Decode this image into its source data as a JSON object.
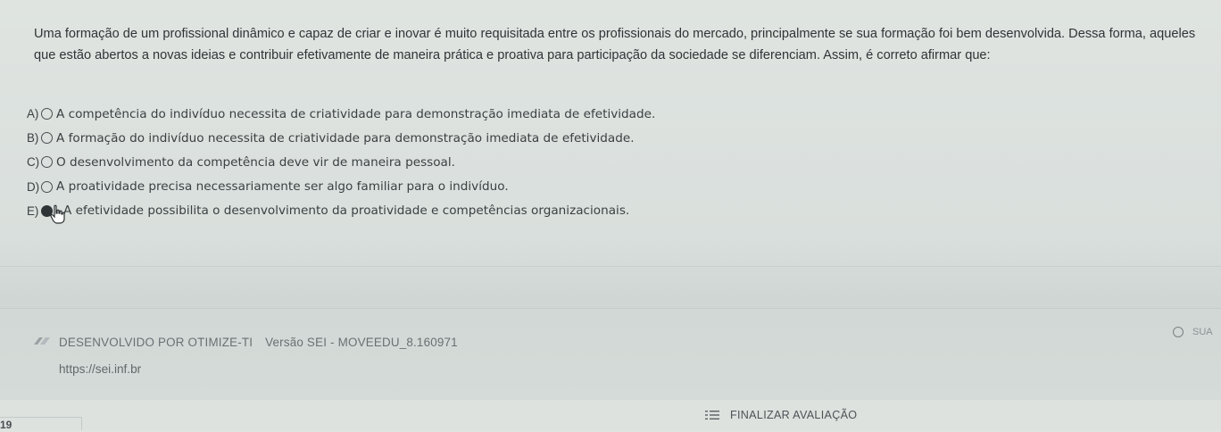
{
  "question": {
    "text": "Uma formação de um profissional dinâmico e capaz de criar e inovar é muito requisitada entre os profissionais do mercado, principalmente se sua formação foi bem desenvolvida. Dessa forma, aqueles que estão abertos a novas ideias e contribuir efetivamente de maneira prática e proativa para participação da sociedade se diferenciam. Assim, é correto afirmar que:"
  },
  "options": [
    {
      "letter": "A)",
      "text": "A competência do indivíduo necessita de criatividade para demonstração imediata de efetividade.",
      "selected": false
    },
    {
      "letter": "B)",
      "text": "A formação do indivíduo necessita de criatividade para demonstração imediata de efetividade.",
      "selected": false
    },
    {
      "letter": "C)",
      "text": "O desenvolvimento da competência deve vir de maneira pessoal.",
      "selected": false
    },
    {
      "letter": "D)",
      "text": "A proatividade precisa necessariamente ser algo familiar para o indivíduo.",
      "selected": false
    },
    {
      "letter": "E)",
      "text": "A efetividade possibilita o desenvolvimento da proatividade e competências organizacionais.",
      "selected": true
    }
  ],
  "footer": {
    "developer": "DESENVOLVIDO POR OTIMIZE-TI",
    "version": "Versão SEI - MOVEEDU_8.160971",
    "url": "https://sei.inf.br",
    "right_label": "SUA"
  },
  "bottom_bar": {
    "page_number": "19",
    "finish_label": "FINALIZAR AVALIAÇÃO"
  },
  "icons": {
    "logo": "sei-logo-icon",
    "clock": "clock-icon",
    "finish": "list-check-icon",
    "cursor": "hand-pointer-icon"
  }
}
